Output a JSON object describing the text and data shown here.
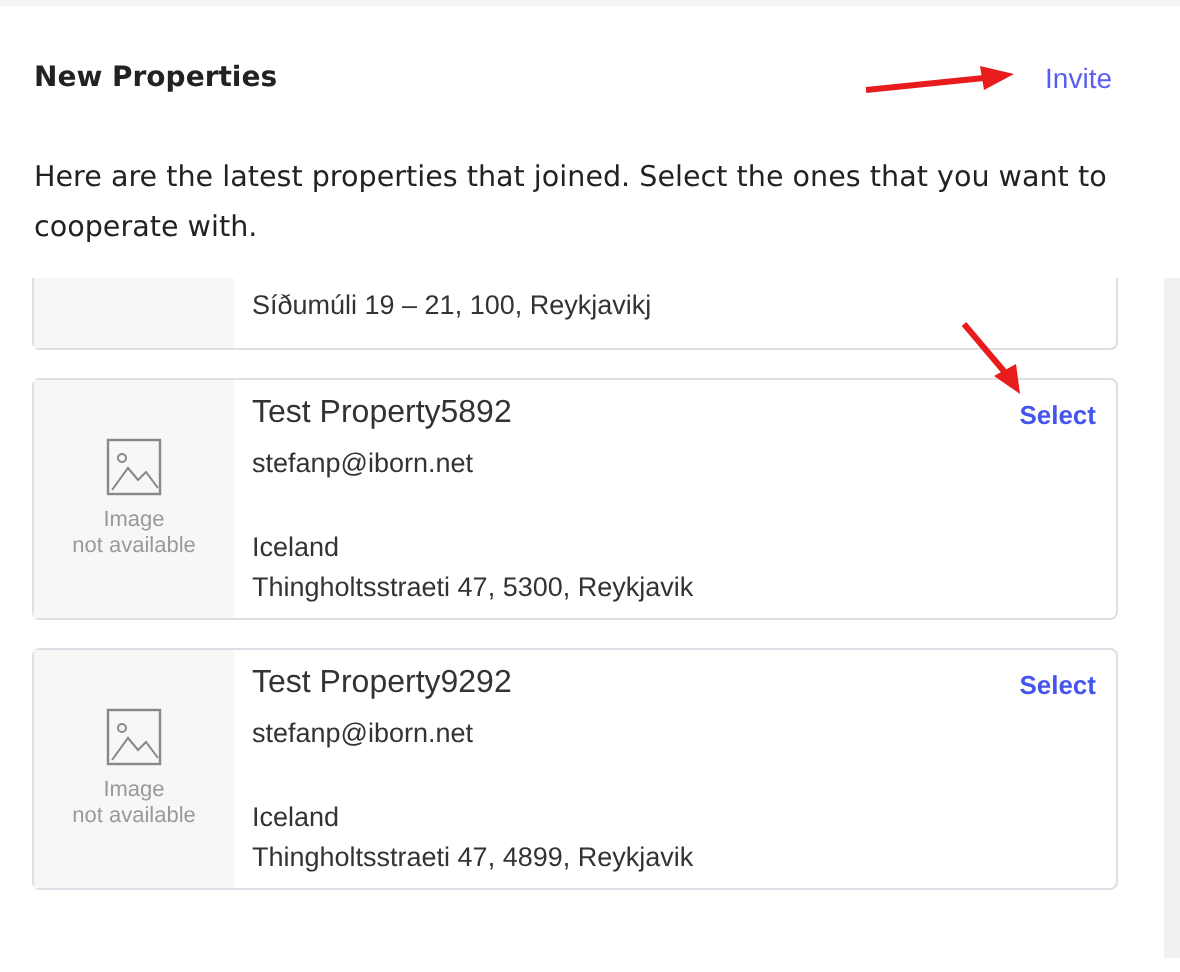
{
  "header": {
    "title": "New Properties",
    "action": "Invite"
  },
  "description": "Here are the latest properties that joined. Select the ones that you want to cooperate with.",
  "properties": [
    {
      "kind": "partial",
      "address": "Síðumúli 19 – 21, 100, Reykjavikj"
    },
    {
      "kind": "full",
      "name": "Test Property5892",
      "email": "stefanp@iborn.net",
      "image_caption": [
        "Image",
        "not available"
      ],
      "country": "Iceland",
      "address": "Thingholtsstraeti 47, 5300, Reykjavik",
      "action": "Select"
    },
    {
      "kind": "full",
      "name": "Test Property9292",
      "email": "stefanp@iborn.net",
      "image_caption": [
        "Image",
        "not available"
      ],
      "country": "Iceland",
      "address": "Thingholtsstraeti 47, 4899, Reykjavik",
      "action": "Select"
    }
  ]
}
